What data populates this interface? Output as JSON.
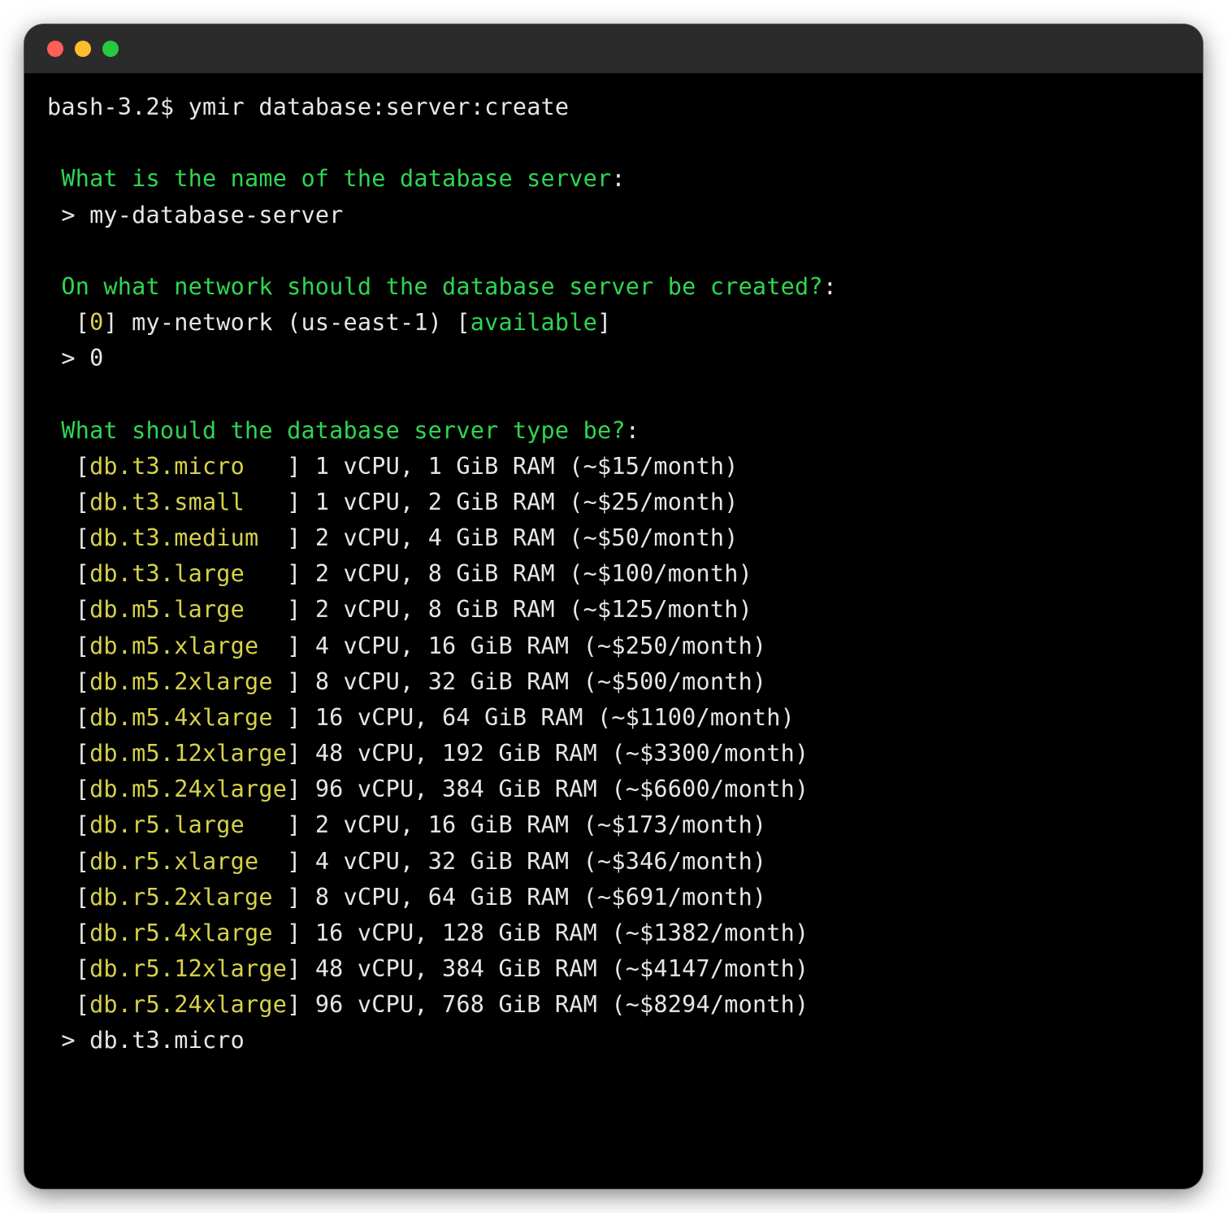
{
  "prompt": "bash-3.2$ ",
  "command": "ymir database:server:create",
  "q_name": "What is the name of the database server",
  "ans_name": "my-database-server",
  "q_network": "On what network should the database server be created?",
  "network_option": {
    "idx": "0",
    "label": "my-network (us-east-1)",
    "status": "available"
  },
  "ans_network": "0",
  "q_type": "What should the database server type be?",
  "types": [
    {
      "name": "db.t3.micro",
      "pad": "   ",
      "desc": "1 vCPU, 1 GiB RAM (~$15/month)"
    },
    {
      "name": "db.t3.small",
      "pad": "   ",
      "desc": "1 vCPU, 2 GiB RAM (~$25/month)"
    },
    {
      "name": "db.t3.medium",
      "pad": "  ",
      "desc": "2 vCPU, 4 GiB RAM (~$50/month)"
    },
    {
      "name": "db.t3.large",
      "pad": "   ",
      "desc": "2 vCPU, 8 GiB RAM (~$100/month)"
    },
    {
      "name": "db.m5.large",
      "pad": "   ",
      "desc": "2 vCPU, 8 GiB RAM (~$125/month)"
    },
    {
      "name": "db.m5.xlarge",
      "pad": "  ",
      "desc": "4 vCPU, 16 GiB RAM (~$250/month)"
    },
    {
      "name": "db.m5.2xlarge",
      "pad": " ",
      "desc": "8 vCPU, 32 GiB RAM (~$500/month)"
    },
    {
      "name": "db.m5.4xlarge",
      "pad": " ",
      "desc": "16 vCPU, 64 GiB RAM (~$1100/month)"
    },
    {
      "name": "db.m5.12xlarge",
      "pad": "",
      "desc": "48 vCPU, 192 GiB RAM (~$3300/month)"
    },
    {
      "name": "db.m5.24xlarge",
      "pad": "",
      "desc": "96 vCPU, 384 GiB RAM (~$6600/month)"
    },
    {
      "name": "db.r5.large",
      "pad": "   ",
      "desc": "2 vCPU, 16 GiB RAM (~$173/month)"
    },
    {
      "name": "db.r5.xlarge",
      "pad": "  ",
      "desc": "4 vCPU, 32 GiB RAM (~$346/month)"
    },
    {
      "name": "db.r5.2xlarge",
      "pad": " ",
      "desc": "8 vCPU, 64 GiB RAM (~$691/month)"
    },
    {
      "name": "db.r5.4xlarge",
      "pad": " ",
      "desc": "16 vCPU, 128 GiB RAM (~$1382/month)"
    },
    {
      "name": "db.r5.12xlarge",
      "pad": "",
      "desc": "48 vCPU, 384 GiB RAM (~$4147/month)"
    },
    {
      "name": "db.r5.24xlarge",
      "pad": "",
      "desc": "96 vCPU, 768 GiB RAM (~$8294/month)"
    }
  ],
  "ans_type": "db.t3.micro"
}
